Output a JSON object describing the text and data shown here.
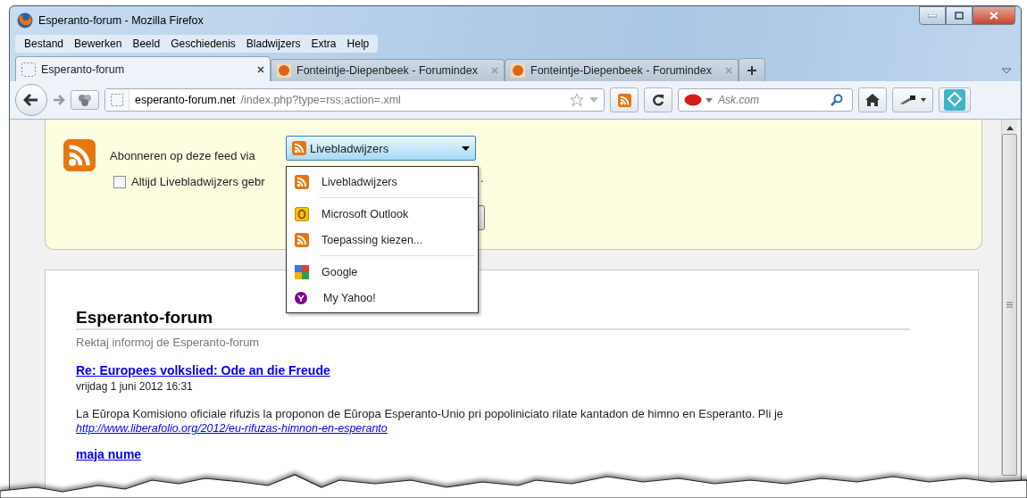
{
  "window": {
    "title": "Esperanto-forum - Mozilla Firefox"
  },
  "menu": [
    "Bestand",
    "Bewerken",
    "Beeld",
    "Geschiedenis",
    "Bladwijzers",
    "Extra",
    "Help"
  ],
  "tabs": [
    {
      "label": "Esperanto-forum",
      "selected": true,
      "kind": "blank"
    },
    {
      "label": "Fonteintje-Diepenbeek - Forumindex",
      "selected": false,
      "kind": "site"
    },
    {
      "label": "Fonteintje-Diepenbeek - Forumindex",
      "selected": false,
      "kind": "site"
    }
  ],
  "address": {
    "domain": "esperanto-forum.net",
    "path": "/index.php?type=rss;action=.xml"
  },
  "search": {
    "placeholder": "Ask.com"
  },
  "feed": {
    "label": "Abonneren op deze feed via",
    "selected_reader": "Livebladwijzers",
    "always_label": "Altijd Livebladwijzers gebr",
    "always_checked": false,
    "trailing": "."
  },
  "reader_menu": [
    [
      {
        "label": "Livebladwijzers",
        "kind": "feed"
      }
    ],
    [
      {
        "label": "Microsoft Outlook",
        "kind": "outlook"
      },
      {
        "label": "Toepassing kiezen...",
        "kind": "feed"
      }
    ],
    [
      {
        "label": "Google",
        "kind": "google"
      },
      {
        "label": "My Yahoo!",
        "kind": "yahoo"
      }
    ]
  ],
  "feed_body": {
    "title": "Esperanto-forum",
    "subtitle": "Rektaj informoj de Esperanto-forum",
    "entries": [
      {
        "title": "Re: Europees volkslied: Ode an die Freude",
        "date": "vrijdag 1 juni 2012 16:31",
        "text": "La Eŭropa Komisiono oficiale rifuzis la proponon de Eŭropa Esperanto-Unio pri popoliniciato rilate kantadon de himno en Esperanto. Pli je",
        "link": "http://www.liberafolio.org/2012/eu-rifuzas-himnon-en-esperanto"
      },
      {
        "title": "maja nume"
      }
    ]
  }
}
